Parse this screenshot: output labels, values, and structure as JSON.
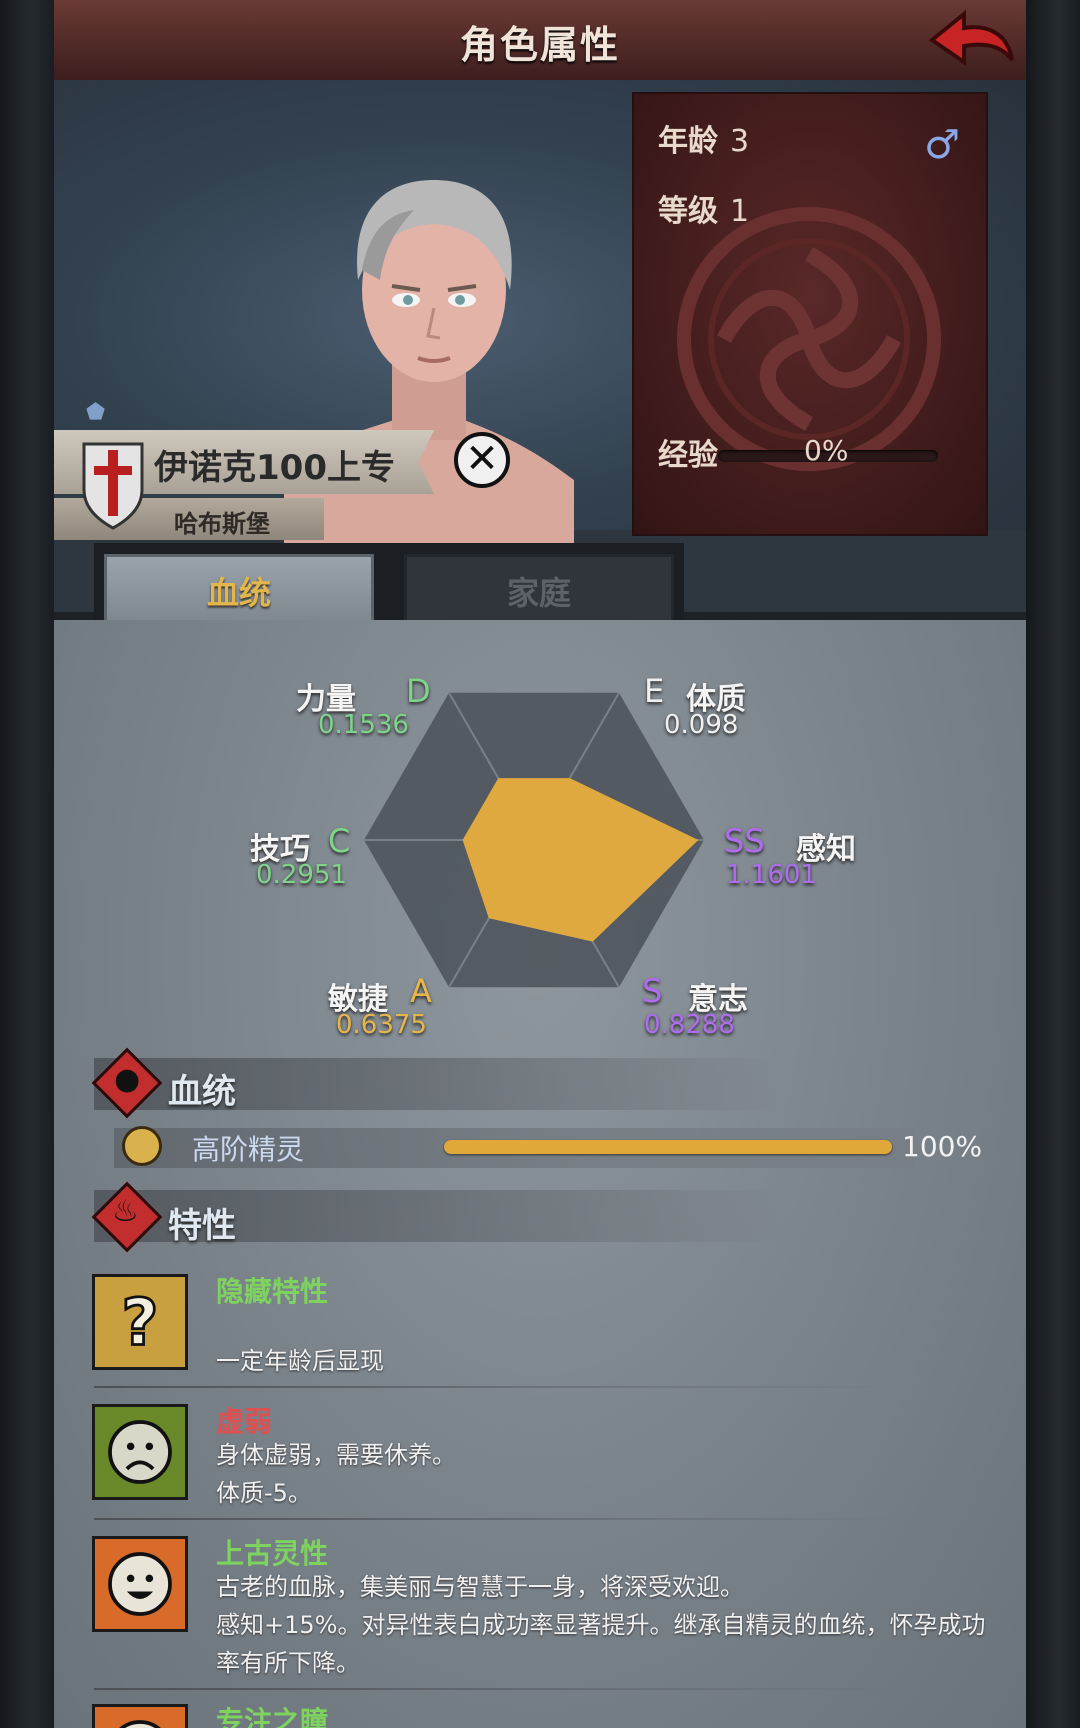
{
  "header": {
    "title": "角色属性",
    "back_icon": "back-arrow-icon"
  },
  "character": {
    "age_label": "年龄",
    "age": "3",
    "level_label": "等级",
    "level": "1",
    "exp_label": "经验",
    "exp_pct": "0%",
    "exp_fraction": 0,
    "gender_symbol": "♂",
    "name": "伊诺克100上专",
    "place": "哈布斯堡",
    "close_symbol": "✕"
  },
  "tabs": [
    {
      "label": "血统",
      "active": true
    },
    {
      "label": "家庭",
      "active": false
    }
  ],
  "attributes": [
    {
      "name": "力量",
      "grade": "D",
      "value": "0.1536",
      "color": "#7fd48a"
    },
    {
      "name": "体质",
      "grade": "E",
      "value": "0.098",
      "color": "#f0f0f0"
    },
    {
      "name": "感知",
      "grade": "SS",
      "value": "1.1601",
      "color": "#b06cf0"
    },
    {
      "name": "意志",
      "grade": "S",
      "value": "0.8288",
      "color": "#b06cf0"
    },
    {
      "name": "敏捷",
      "grade": "A",
      "value": "0.6375",
      "color": "#e6b64a"
    },
    {
      "name": "技巧",
      "grade": "C",
      "value": "0.2951",
      "color": "#7fd48a"
    }
  ],
  "lineage_section": {
    "title": "血统",
    "entries": [
      {
        "name": "高阶精灵",
        "pct": "100%",
        "fraction": 1.0
      }
    ]
  },
  "traits_section": {
    "title": "特性",
    "items": [
      {
        "name": "隐藏特性",
        "color": "#7ed35f",
        "desc1": "一定年龄后显现",
        "desc2": "",
        "icon": "question-mark-icon"
      },
      {
        "name": "虚弱",
        "color": "#e05050",
        "desc1": "身体虚弱，需要休养。",
        "desc2": "体质-5。",
        "icon": "sad-face-icon"
      },
      {
        "name": "上古灵性",
        "color": "#7ed35f",
        "desc1": "古老的血脉，集美丽与智慧于一身，将深受欢迎。",
        "desc2": "感知+15%。对异性表白成功率显著提升。继承自精灵的血统，怀孕成功率有所下降。",
        "icon": "happy-face-icon"
      },
      {
        "name": "专注之瞳",
        "color": "#7ed35f",
        "desc1": "",
        "desc2": "",
        "icon": "eye-icon"
      }
    ]
  }
}
